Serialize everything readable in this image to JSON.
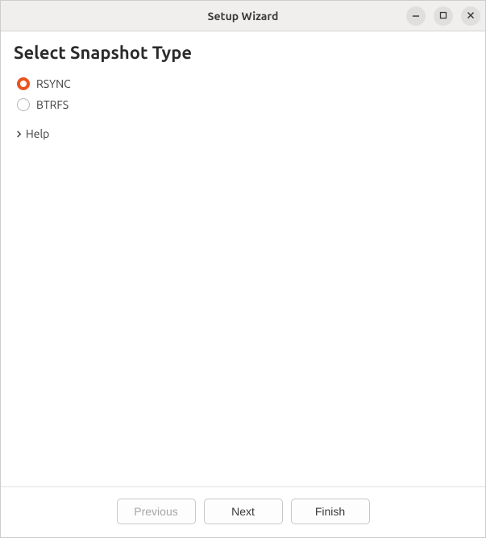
{
  "window": {
    "title": "Setup Wizard"
  },
  "page": {
    "heading": "Select Snapshot Type"
  },
  "snapshot_types": {
    "options": [
      {
        "label": "RSYNC",
        "selected": true
      },
      {
        "label": "BTRFS",
        "selected": false
      }
    ]
  },
  "help": {
    "label": "Help",
    "expanded": false
  },
  "footer": {
    "previous_label": "Previous",
    "previous_enabled": false,
    "next_label": "Next",
    "finish_label": "Finish"
  }
}
